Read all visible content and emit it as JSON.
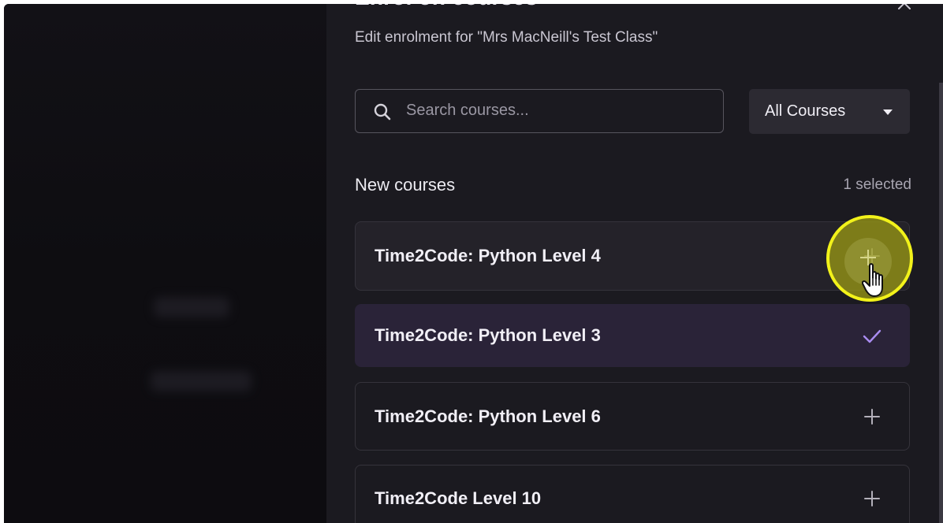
{
  "drawer": {
    "title": "Enrol on courses",
    "subtitle": "Edit enrolment for \"Mrs MacNeill's Test Class\""
  },
  "search": {
    "placeholder": "Search courses...",
    "value": ""
  },
  "filter": {
    "selected": "All Courses"
  },
  "section": {
    "title": "New courses",
    "selected_count": "1 selected"
  },
  "courses": [
    {
      "name": "Time2Code: Python Level 4",
      "state": "hover",
      "action_icon": "plus-icon"
    },
    {
      "name": "Time2Code: Python Level 3",
      "state": "selected",
      "action_icon": "check-icon"
    },
    {
      "name": "Time2Code: Python Level 6",
      "state": "default",
      "action_icon": "plus-icon"
    },
    {
      "name": "Time2Code Level 10",
      "state": "default",
      "action_icon": "plus-icon"
    }
  ],
  "colors": {
    "accent": "#a98cf0",
    "selected_card": "#2a2338",
    "cursor_highlight": "#f2f21a"
  }
}
